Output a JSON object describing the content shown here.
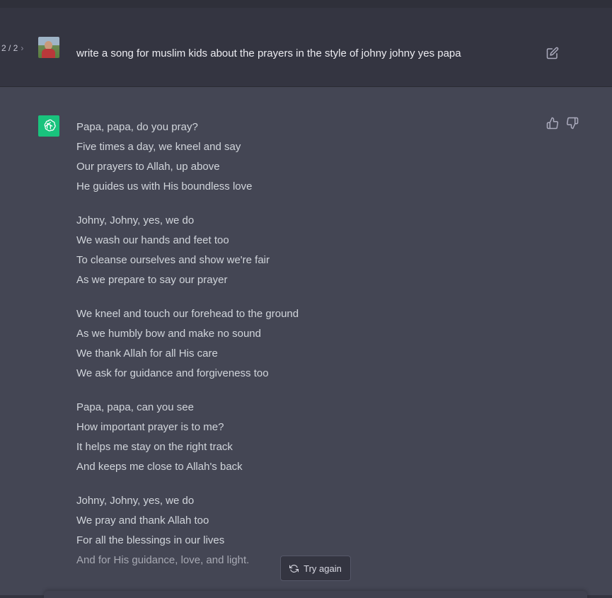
{
  "conversation": {
    "pager": {
      "current_total": "2 / 2",
      "next_symbol": "›"
    },
    "user_message": "write a song for muslim kids about the prayers in the style of johny johny yes papa",
    "assistant_stanzas": [
      [
        "Papa, papa, do you pray?",
        "Five times a day, we kneel and say",
        "Our prayers to Allah, up above",
        "He guides us with His boundless love"
      ],
      [
        "Johny, Johny, yes, we do",
        "We wash our hands and feet too",
        "To cleanse ourselves and show we're fair",
        "As we prepare to say our prayer"
      ],
      [
        "We kneel and touch our forehead to the ground",
        "As we humbly bow and make no sound",
        "We thank Allah for all His care",
        "We ask for guidance and forgiveness too"
      ],
      [
        "Papa, papa, can you see",
        "How important prayer is to me?",
        "It helps me stay on the right track",
        "And keeps me close to Allah's back"
      ],
      [
        "Johny, Johny, yes, we do",
        "We pray and thank Allah too",
        "For all the blessings in our lives",
        "And for His guidance, love, and light."
      ]
    ]
  },
  "actions": {
    "try_again_label": "Try again"
  },
  "icons": {
    "edit": "edit-icon",
    "thumbs_up": "thumbs-up-icon",
    "thumbs_down": "thumbs-down-icon",
    "regenerate": "refresh-icon",
    "assistant_logo": "openai-logo-icon"
  },
  "colors": {
    "page_bg": "#343541",
    "assistant_bg": "#444654",
    "logo_bg": "#19c37d",
    "text": "#d1d5db"
  }
}
